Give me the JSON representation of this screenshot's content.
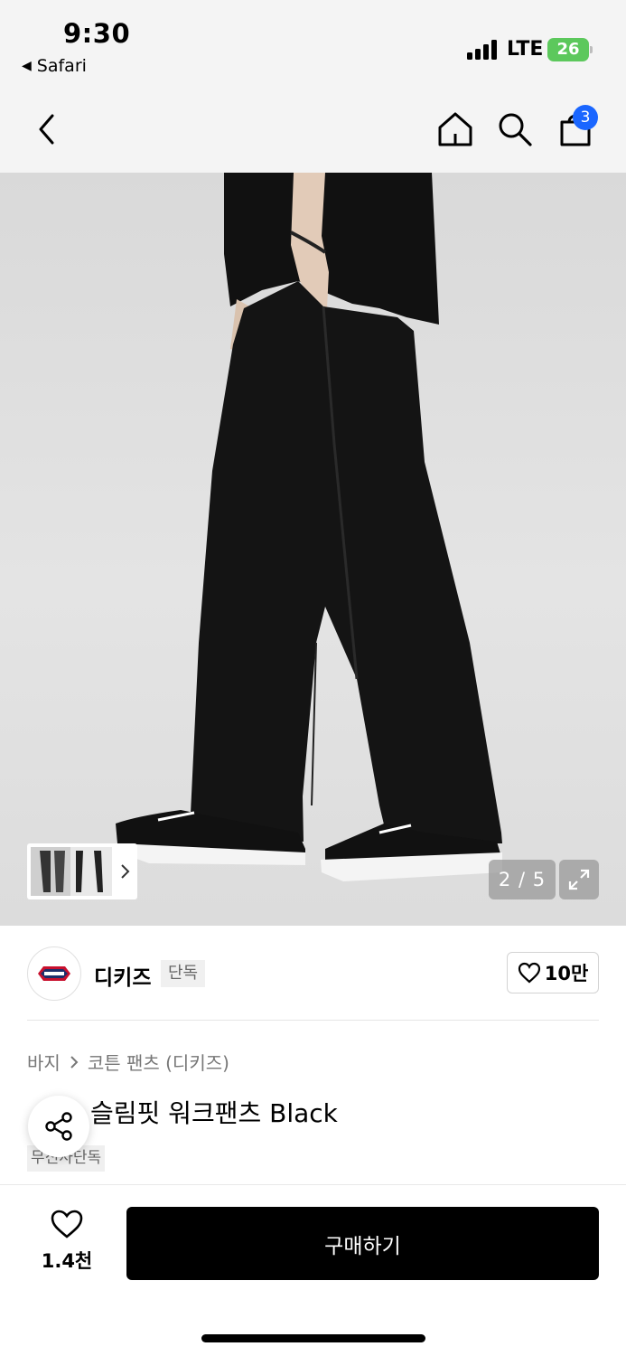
{
  "status_bar": {
    "time": "9:30",
    "back_app": "Safari",
    "network": "LTE",
    "battery": "26"
  },
  "header": {
    "back_icon": "chevron-left-icon",
    "home_icon": "home-icon",
    "search_icon": "search-icon",
    "cart_icon": "shopping-bag-icon",
    "cart_count": "3"
  },
  "gallery": {
    "counter": "2 / 5",
    "expand_icon": "expand-icon"
  },
  "brand": {
    "name": "디키즈",
    "tag": "단독",
    "likes": "10만"
  },
  "breadcrumb": {
    "category": "바지",
    "subcategory": "코튼 팬츠 (디키즈)"
  },
  "product": {
    "title": "슬림핏 워크팬츠 Black",
    "store_tag": "무신사단독"
  },
  "bottom_bar": {
    "wish_count": "1.4천",
    "buy_label": "구매하기"
  },
  "colors": {
    "accent_badge": "#1a66ff",
    "battery": "#5cc85c",
    "buy_button": "#000000"
  }
}
